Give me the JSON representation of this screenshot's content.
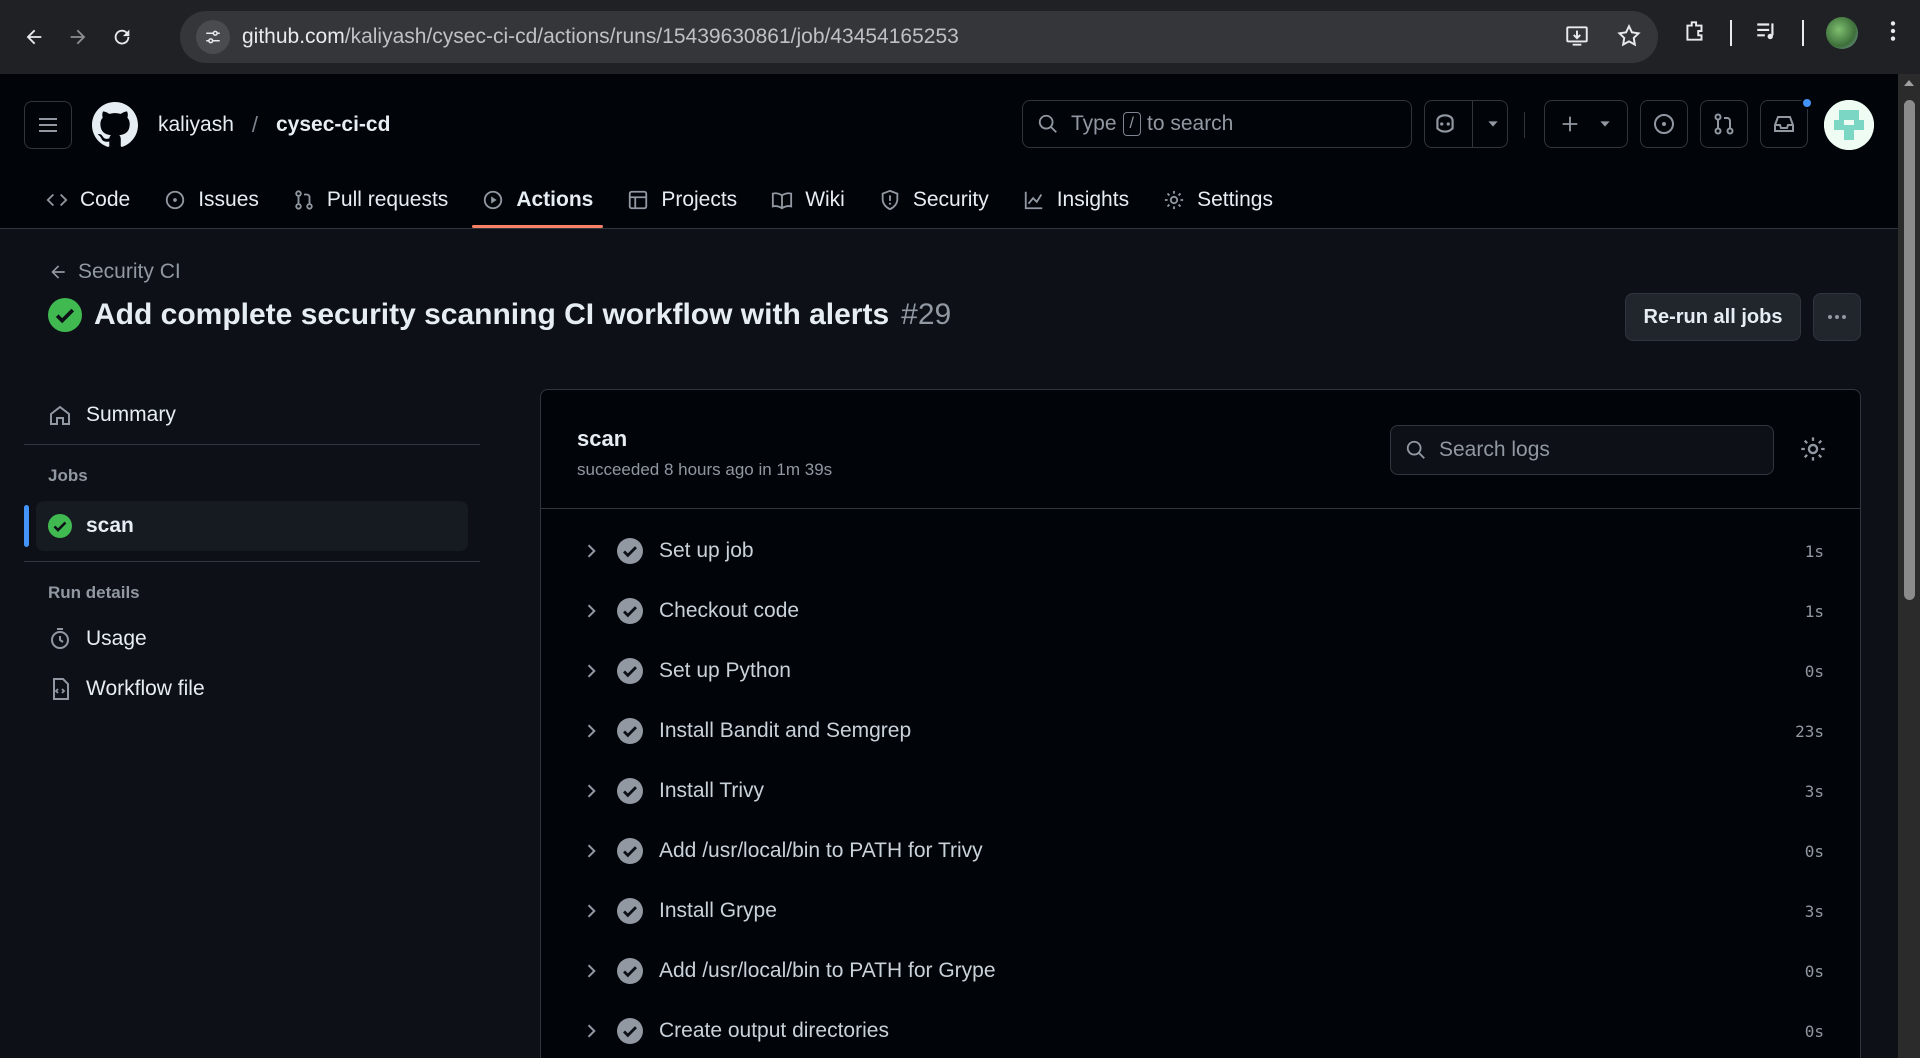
{
  "browser": {
    "url_host": "github.com",
    "url_path": "/kaliyash/cysec-ci-cd/actions/runs/15439630861/job/43454165253"
  },
  "header": {
    "owner": "kaliyash",
    "separator": "/",
    "repo": "cysec-ci-cd",
    "search_prefix": "Type",
    "search_kbd": "/",
    "search_suffix": "to search"
  },
  "tabs": [
    {
      "label": "Code"
    },
    {
      "label": "Issues"
    },
    {
      "label": "Pull requests"
    },
    {
      "label": "Actions"
    },
    {
      "label": "Projects"
    },
    {
      "label": "Wiki"
    },
    {
      "label": "Security"
    },
    {
      "label": "Insights"
    },
    {
      "label": "Settings"
    }
  ],
  "run": {
    "back_label": "Security CI",
    "title": "Add complete security scanning CI workflow with alerts",
    "number": "#29",
    "rerun_label": "Re-run all jobs"
  },
  "sidebar": {
    "summary": "Summary",
    "jobs_heading": "Jobs",
    "job": "scan",
    "run_details_heading": "Run details",
    "usage": "Usage",
    "workflow_file": "Workflow file"
  },
  "job": {
    "name": "scan",
    "meta": "succeeded 8 hours ago in 1m 39s",
    "search_placeholder": "Search logs",
    "steps": [
      {
        "label": "Set up job",
        "duration": "1s"
      },
      {
        "label": "Checkout code",
        "duration": "1s"
      },
      {
        "label": "Set up Python",
        "duration": "0s"
      },
      {
        "label": "Install Bandit and Semgrep",
        "duration": "23s"
      },
      {
        "label": "Install Trivy",
        "duration": "3s"
      },
      {
        "label": "Add /usr/local/bin to PATH for Trivy",
        "duration": "0s"
      },
      {
        "label": "Install Grype",
        "duration": "3s"
      },
      {
        "label": "Add /usr/local/bin to PATH for Grype",
        "duration": "0s"
      },
      {
        "label": "Create output directories",
        "duration": "0s"
      }
    ]
  },
  "colors": {
    "success": "#3fb950",
    "accent_underline": "#f78166",
    "selected_marker": "#4493f8",
    "background": "#0d1117"
  }
}
